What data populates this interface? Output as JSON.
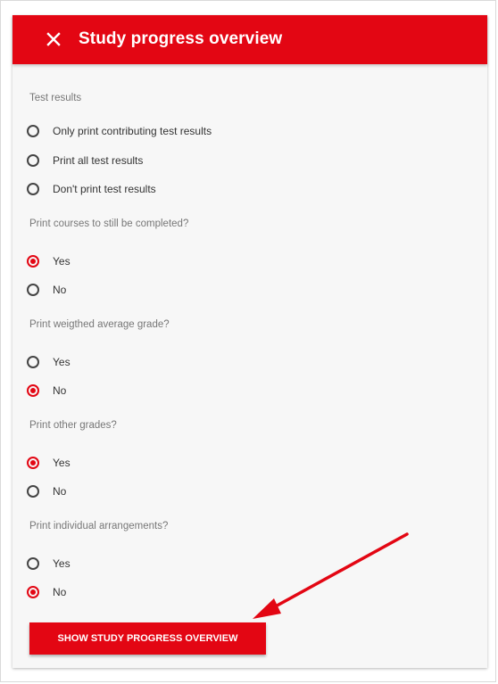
{
  "dialog": {
    "title": "Study progress overview",
    "close_icon": "close-icon"
  },
  "sections": [
    {
      "label": "Test results",
      "options": [
        {
          "label": "Only print contributing test results",
          "checked": false
        },
        {
          "label": "Print all test results",
          "checked": false
        },
        {
          "label": "Don't print test results",
          "checked": false
        }
      ]
    },
    {
      "label": "Print courses to still be completed?",
      "options": [
        {
          "label": "Yes",
          "checked": true
        },
        {
          "label": "No",
          "checked": false
        }
      ]
    },
    {
      "label": "Print weigthed average grade?",
      "options": [
        {
          "label": "Yes",
          "checked": false
        },
        {
          "label": "No",
          "checked": true
        }
      ]
    },
    {
      "label": "Print other grades?",
      "options": [
        {
          "label": "Yes",
          "checked": true
        },
        {
          "label": "No",
          "checked": false
        }
      ]
    },
    {
      "label": "Print individual arrangements?",
      "options": [
        {
          "label": "Yes",
          "checked": false
        },
        {
          "label": "No",
          "checked": true
        }
      ]
    }
  ],
  "button": {
    "label": "SHOW STUDY PROGRESS OVERVIEW"
  },
  "colors": {
    "accent": "#e30613",
    "annotation_arrow": "#e30613"
  }
}
